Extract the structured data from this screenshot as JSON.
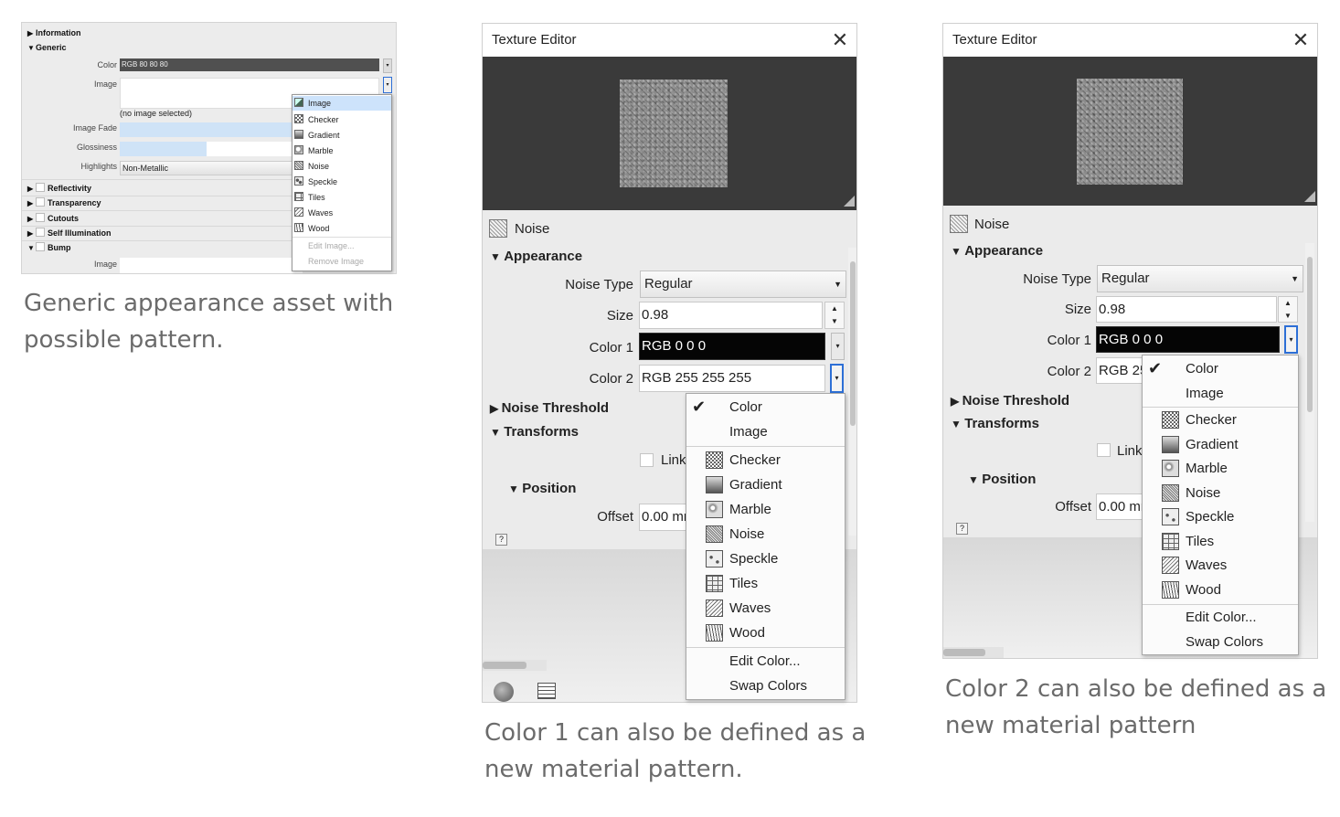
{
  "panel1": {
    "sections": {
      "information": "Information",
      "generic": "Generic",
      "reflectivity": "Reflectivity",
      "transparency": "Transparency",
      "cutouts": "Cutouts",
      "self_illumination": "Self Illumination",
      "bump": "Bump"
    },
    "labels": {
      "color": "Color",
      "image": "Image",
      "image_fade": "Image Fade",
      "glossiness": "Glossiness",
      "highlights": "Highlights",
      "bump_image": "Image"
    },
    "values": {
      "color": "RGB 80 80 80",
      "no_image": "(no image selected)",
      "highlights": "Non-Metallic"
    },
    "menu": [
      "Image",
      "Checker",
      "Gradient",
      "Marble",
      "Noise",
      "Speckle",
      "Tiles",
      "Waves",
      "Wood"
    ],
    "menu_disabled": [
      "Edit Image...",
      "Remove Image"
    ],
    "caption": "Generic appearance asset with possible pattern."
  },
  "dialog": {
    "title": "Texture Editor",
    "texture_name": "Noise",
    "appearance": "Appearance",
    "noise_type_label": "Noise Type",
    "noise_type_value": "Regular",
    "size_label": "Size",
    "size_value": "0.98",
    "color1_label": "Color 1",
    "color1_value": "RGB 0 0 0",
    "color2_label": "Color 2",
    "color2_value": "RGB 255 255 255",
    "color2_value_truncated": "RGB 25",
    "noise_threshold": "Noise Threshold",
    "transforms": "Transforms",
    "link": "Link",
    "position": "Position",
    "offset_label": "Offset",
    "offset_value": "0.00 mr",
    "help": "?"
  },
  "menu2": {
    "items_top": [
      "Color",
      "Image"
    ],
    "patterns": [
      "Checker",
      "Gradient",
      "Marble",
      "Noise",
      "Speckle",
      "Tiles",
      "Waves",
      "Wood"
    ],
    "actions": [
      "Edit Color...",
      "Swap Colors"
    ]
  },
  "captions": {
    "middle": "Color 1 can also be defined as a new material pattern.",
    "right": "Color 2 can also be defined as a new material pattern"
  },
  "icons": {
    "check": "checkmark-icon",
    "close": "close-icon"
  }
}
